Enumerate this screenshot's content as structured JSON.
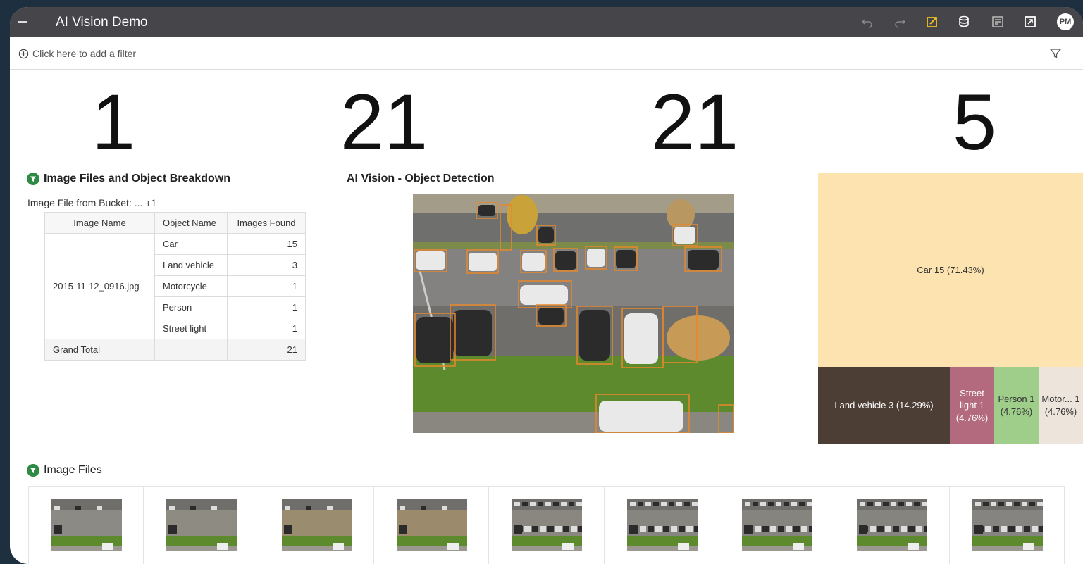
{
  "header": {
    "title": "AI Vision Demo",
    "avatar_initials": "PM",
    "icons": [
      "undo-icon",
      "redo-icon",
      "edit-icon",
      "data-icon",
      "comment-icon",
      "present-icon"
    ]
  },
  "filter_bar": {
    "add_filter_label": "Click here to add a filter"
  },
  "kpis": [
    {
      "value": "1"
    },
    {
      "value": "21"
    },
    {
      "value": "21"
    },
    {
      "value": "5"
    }
  ],
  "breakdown": {
    "title": "Image Files and Object Breakdown",
    "filter_label": "Image File from Bucket: ... +1",
    "columns": [
      "Image Name",
      "Object Name",
      "Images Found"
    ],
    "image_name": "2015-11-12_0916.jpg",
    "rows": [
      {
        "object": "Car",
        "count": "15"
      },
      {
        "object": "Land vehicle",
        "count": "3"
      },
      {
        "object": "Motorcycle",
        "count": "1"
      },
      {
        "object": "Person",
        "count": "1"
      },
      {
        "object": "Street light",
        "count": "1"
      }
    ],
    "grand_total_label": "Grand Total",
    "grand_total": "21"
  },
  "detection": {
    "title": "AI Vision - Object Detection"
  },
  "treemap": {
    "cells": [
      {
        "label": "Car 15 (71.43%)",
        "color": "#fde3b0"
      },
      {
        "label": "Land vehicle 3 (14.29%)",
        "color": "#4c3d35"
      },
      {
        "label": "Street light 1 (4.76%)",
        "color": "#b36a7f"
      },
      {
        "label": "Person 1 (4.76%)",
        "color": "#9fcd8a"
      },
      {
        "label": "Motor... 1 (4.76%)",
        "color": "#ede4dc"
      }
    ]
  },
  "image_files": {
    "title": "Image Files",
    "thumbnail_count": 9
  },
  "colors": {
    "header_bg": "#46464a",
    "accent_green": "#2f8a46",
    "edit_icon": "#f0c020",
    "box_orange": "#e8882a"
  }
}
